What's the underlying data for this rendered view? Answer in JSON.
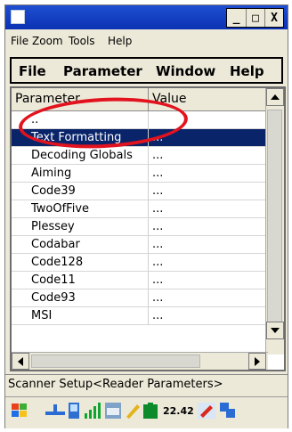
{
  "window": {
    "buttons": {
      "minimize": "_",
      "maximize": "□",
      "close": "X"
    }
  },
  "menu1": [
    "File",
    "Zoom",
    "Tools",
    "Help"
  ],
  "menu2": [
    "File",
    "Parameter",
    "Window",
    "Help"
  ],
  "grid": {
    "headers": {
      "parameter": "Parameter",
      "value": "Value"
    },
    "rows": [
      {
        "name": "..",
        "value": ""
      },
      {
        "name": "Text Formatting",
        "value": "..."
      },
      {
        "name": "Decoding Globals",
        "value": "..."
      },
      {
        "name": "Aiming",
        "value": "..."
      },
      {
        "name": "Code39",
        "value": "..."
      },
      {
        "name": "TwoOfFive",
        "value": "..."
      },
      {
        "name": "Plessey",
        "value": "..."
      },
      {
        "name": "Codabar",
        "value": "..."
      },
      {
        "name": "Code128",
        "value": "..."
      },
      {
        "name": "Code11",
        "value": "..."
      },
      {
        "name": "Code93",
        "value": "..."
      },
      {
        "name": "MSI",
        "value": "..."
      }
    ],
    "selected_index": 1
  },
  "status": {
    "text": "Scanner Setup<Reader Parameters>"
  },
  "taskbar": {
    "clock": "22.42"
  },
  "icons": [
    "start-flag-icon",
    "network-icon",
    "device-icon",
    "signal-icon",
    "keyboard-icon",
    "pen-icon",
    "battery-icon",
    "tools-icon"
  ],
  "colors": {
    "titlebar": "#0a32b3",
    "selection": "#0a246a",
    "annotation": "#e2131e"
  }
}
